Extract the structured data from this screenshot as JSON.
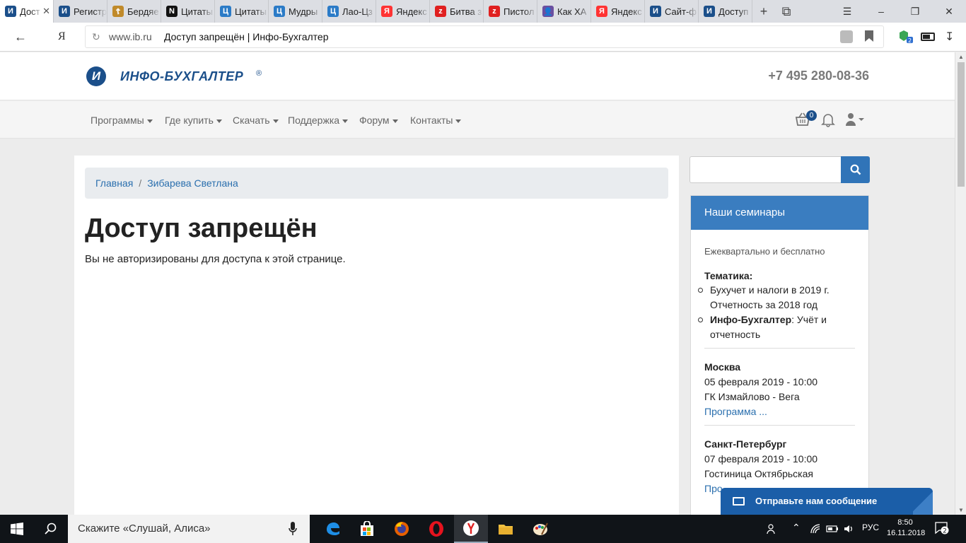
{
  "browser": {
    "tabs": [
      {
        "label": "Дост",
        "icon": "ib-icon",
        "color": "#1b4f8a",
        "glyph": "И",
        "active": true
      },
      {
        "label": "Регистр",
        "icon": "ib-icon",
        "color": "#1b4f8a",
        "glyph": "И"
      },
      {
        "label": "Бердяе",
        "icon": "cross-icon",
        "color": "#c08a2a",
        "glyph": "☦"
      },
      {
        "label": "Цитаты",
        "icon": "n-icon",
        "color": "#111111",
        "glyph": "N"
      },
      {
        "label": "Цитаты",
        "icon": "ts-icon",
        "color": "#2b7bc7",
        "glyph": "Ц"
      },
      {
        "label": "Мудры",
        "icon": "ts-icon",
        "color": "#2b7bc7",
        "glyph": "Ц"
      },
      {
        "label": "Лао-Цз",
        "icon": "ts-icon",
        "color": "#2b7bc7",
        "glyph": "Ц"
      },
      {
        "label": "Яндекс",
        "icon": "yandex-icon",
        "color": "#ff3333",
        "glyph": "Я"
      },
      {
        "label": "Битва з",
        "icon": "zen-icon",
        "color": "#e02020",
        "glyph": "z"
      },
      {
        "label": "Пистол",
        "icon": "zen-icon",
        "color": "#e02020",
        "glyph": "z"
      },
      {
        "label": "Как ХА",
        "icon": "person-icon",
        "color": "#6a4fa0",
        "glyph": "👤"
      },
      {
        "label": "Яндекс",
        "icon": "yandex-icon",
        "color": "#ff3333",
        "glyph": "Я"
      },
      {
        "label": "Сайт-ф",
        "icon": "ib-icon",
        "color": "#1b4f8a",
        "glyph": "И"
      },
      {
        "label": "Доступ",
        "icon": "ib-icon",
        "color": "#1b4f8a",
        "glyph": "И"
      }
    ],
    "domain": "www.ib.ru",
    "page_title": "Доступ запрещён | Инфо-Бухгалтер",
    "ya_label": "Я"
  },
  "site": {
    "logo_text": "ИНФО-БУХГАЛТЕР",
    "logo_reg": "®",
    "logo_glyph": "И",
    "phone": "+7 495 280-08-36",
    "nav": [
      "Программы",
      "Где купить",
      "Скачать",
      "Поддержка",
      "Форум",
      "Контакты"
    ],
    "cart_count": "0",
    "breadcrumb": {
      "home": "Главная",
      "sep": "/",
      "current": "Зибарева Светлана"
    },
    "heading": "Доступ запрещён",
    "message": "Вы не авторизированы для доступа к этой странице.",
    "search_placeholder": "",
    "seminars": {
      "title": "Наши семинары",
      "subtitle": "Ежеквартально и бесплатно",
      "topic_label": "Тематика:",
      "topics": [
        "Бухучет и налоги в 2019 г. Отчетность за 2018 год"
      ],
      "topic2_bold": "Инфо-Бухгалтер",
      "topic2_rest": ": Учёт и отчетность",
      "events": [
        {
          "city": "Москва",
          "date": "05 февраля 2019 - 10:00",
          "place": "ГК Измайлово - Вега",
          "link": "Программа ..."
        },
        {
          "city": "Санкт-Петербург",
          "date": "07 февраля 2019 - 10:00",
          "place": "Гостиница Октябрьская",
          "link": "Про"
        }
      ]
    },
    "chat_label": "Отправьте нам сообщение"
  },
  "taskbar": {
    "search_text": "Скажите «Слушай, Алиса»",
    "lang": "РУС",
    "time": "8:50",
    "date": "16.11.2018",
    "notifications": "2"
  },
  "colors": {
    "brand": "#1b4f8a",
    "accent": "#3a7dc0",
    "link": "#2a6fae"
  }
}
